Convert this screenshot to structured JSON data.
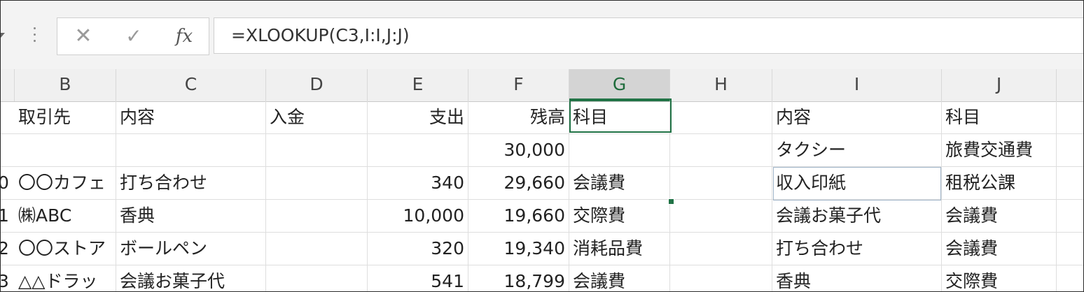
{
  "formula_bar": {
    "cancel_label": "✕",
    "enter_label": "✓",
    "fx_label": "fx",
    "formula": "=XLOOKUP(C3,I:I,J:J)"
  },
  "columns": [
    "B",
    "C",
    "D",
    "E",
    "F",
    "G",
    "H",
    "I",
    "J"
  ],
  "selected_column": "G",
  "rows": [
    {
      "rn": "",
      "B": "取引先",
      "C": "内容",
      "D": "入金",
      "E": "支出",
      "F": "残高",
      "G": "科目",
      "H": "",
      "I": "内容",
      "J": "科目"
    },
    {
      "rn": "",
      "B": "",
      "C": "",
      "D": "",
      "E": "",
      "F": "30,000",
      "G": "",
      "H": "",
      "I": "タクシー",
      "J": "旅費交通費"
    },
    {
      "rn": "0",
      "B": "〇〇カフェ",
      "C": "打ち合わせ",
      "D": "",
      "E": "340",
      "F": "29,660",
      "G": "会議費",
      "H": "",
      "I": "収入印紙",
      "J": "租税公課"
    },
    {
      "rn": "1",
      "B": "㈱ABC",
      "C": "香典",
      "D": "",
      "E": "10,000",
      "F": "19,660",
      "G": "交際費",
      "H": "",
      "I": "会議お菓子代",
      "J": "会議費"
    },
    {
      "rn": "2",
      "B": "〇〇ストア",
      "C": "ボールペン",
      "D": "",
      "E": "320",
      "F": "19,340",
      "G": "消耗品費",
      "H": "",
      "I": "打ち合わせ",
      "J": "会議費"
    },
    {
      "rn": "3",
      "B": "△△ドラッ",
      "C": "会議お菓子代",
      "D": "",
      "E": "541",
      "F": "18,799",
      "G": "会議費",
      "H": "",
      "I": "香典",
      "J": "交際費"
    }
  ],
  "colors": {
    "accent": "#217346",
    "header_bg": "#f0f0f0",
    "selected_header_bg": "#d4d4d4"
  }
}
